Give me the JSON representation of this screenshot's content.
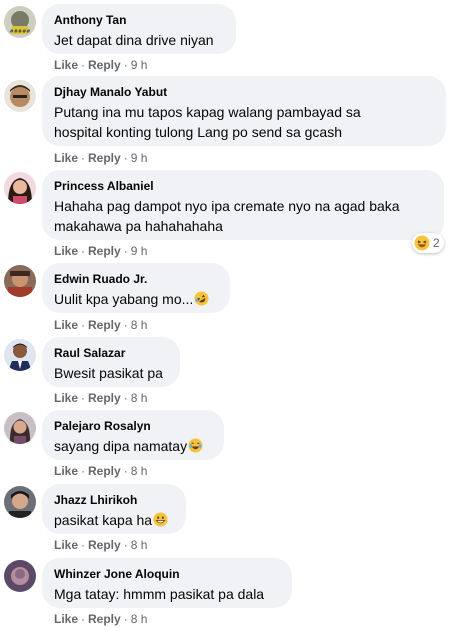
{
  "labels": {
    "like": "Like",
    "reply": "Reply",
    "sep": "·"
  },
  "comments": [
    {
      "author": "Anthony Tan",
      "text": "Jet dapat dina drive niyan",
      "time": "9 h"
    },
    {
      "author": "Djhay Manalo Yabut",
      "text": "Putang ina mu tapos kapag walang pambayad sa\nhospital konting tulong Lang po send sa gcash",
      "time": "9 h"
    },
    {
      "author": "Princess Albaniel",
      "text": "Hahaha pag dampot nyo ipa cremate nyo na agad baka\nmakahawa pa hahahahaha",
      "time": "9 h",
      "reaction_icon": "laughing-reaction-icon",
      "reaction_count": "2"
    },
    {
      "author": "Edwin Ruado Jr.",
      "text": "Uulit kpa yabang mo...",
      "emoji": "rolling-laughing-emoji",
      "time": "8 h"
    },
    {
      "author": "Raul Salazar",
      "text": "Bwesit pasikat pa",
      "time": "8 h"
    },
    {
      "author": "Palejaro Rosalyn",
      "text": "sayang dipa namatay",
      "emoji": "tears-of-joy-emoji",
      "time": "8 h"
    },
    {
      "author": "Jhazz Lhirikoh",
      "text": "pasikat kapa ha",
      "emoji": "grinning-emoji",
      "time": "8 h"
    },
    {
      "author": "Whinzer Jone Aloquin",
      "text": "Mga tatay: hmmm pasikat pa dala",
      "time": "8 h"
    }
  ],
  "colors": {
    "bubble": "#f0f2f5",
    "meta": "#65676b",
    "text": "#050505"
  }
}
